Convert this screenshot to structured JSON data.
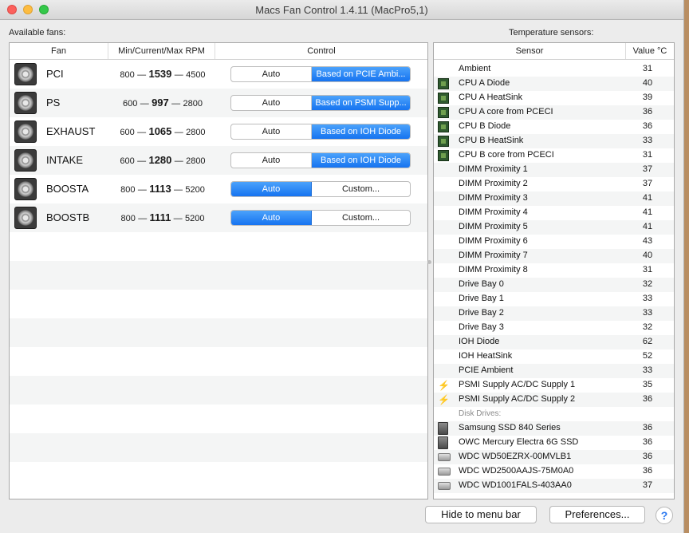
{
  "window": {
    "title": "Macs Fan Control 1.4.11 (MacPro5,1)"
  },
  "fans_panel": {
    "label": "Available fans:",
    "headers": {
      "fan": "Fan",
      "rpm": "Min/Current/Max RPM",
      "control": "Control"
    },
    "dash": "—",
    "rows": [
      {
        "name": "PCI",
        "min": "800",
        "current": "1539",
        "max": "4500",
        "auto": "Auto",
        "option": "Based on PCIE Ambi...",
        "mode": "custom"
      },
      {
        "name": "PS",
        "min": "600",
        "current": "997",
        "max": "2800",
        "auto": "Auto",
        "option": "Based on PSMI Supp...",
        "mode": "custom"
      },
      {
        "name": "EXHAUST",
        "min": "600",
        "current": "1065",
        "max": "2800",
        "auto": "Auto",
        "option": "Based on IOH Diode",
        "mode": "custom"
      },
      {
        "name": "INTAKE",
        "min": "600",
        "current": "1280",
        "max": "2800",
        "auto": "Auto",
        "option": "Based on IOH Diode",
        "mode": "custom"
      },
      {
        "name": "BOOSTA",
        "min": "800",
        "current": "1113",
        "max": "5200",
        "auto": "Auto",
        "option": "Custom...",
        "mode": "auto"
      },
      {
        "name": "BOOSTB",
        "min": "800",
        "current": "1111",
        "max": "5200",
        "auto": "Auto",
        "option": "Custom...",
        "mode": "auto"
      }
    ]
  },
  "sensors_panel": {
    "label": "Temperature sensors:",
    "headers": {
      "sensor": "Sensor",
      "value": "Value °C"
    },
    "rows": [
      {
        "name": "Ambient",
        "value": "31",
        "icon": "none"
      },
      {
        "name": "CPU A Diode",
        "value": "40",
        "icon": "chip"
      },
      {
        "name": "CPU A HeatSink",
        "value": "39",
        "icon": "chip"
      },
      {
        "name": "CPU A core from PCECI",
        "value": "36",
        "icon": "chip"
      },
      {
        "name": "CPU B Diode",
        "value": "36",
        "icon": "chip"
      },
      {
        "name": "CPU B HeatSink",
        "value": "33",
        "icon": "chip"
      },
      {
        "name": "CPU B core from PCECI",
        "value": "31",
        "icon": "chip"
      },
      {
        "name": "DIMM Proximity 1",
        "value": "37",
        "icon": "none"
      },
      {
        "name": "DIMM Proximity 2",
        "value": "37",
        "icon": "none"
      },
      {
        "name": "DIMM Proximity 3",
        "value": "41",
        "icon": "none"
      },
      {
        "name": "DIMM Proximity 4",
        "value": "41",
        "icon": "none"
      },
      {
        "name": "DIMM Proximity 5",
        "value": "41",
        "icon": "none"
      },
      {
        "name": "DIMM Proximity 6",
        "value": "43",
        "icon": "none"
      },
      {
        "name": "DIMM Proximity 7",
        "value": "40",
        "icon": "none"
      },
      {
        "name": "DIMM Proximity 8",
        "value": "31",
        "icon": "none"
      },
      {
        "name": "Drive Bay 0",
        "value": "32",
        "icon": "none"
      },
      {
        "name": "Drive Bay 1",
        "value": "33",
        "icon": "none"
      },
      {
        "name": "Drive Bay 2",
        "value": "33",
        "icon": "none"
      },
      {
        "name": "Drive Bay 3",
        "value": "32",
        "icon": "none"
      },
      {
        "name": "IOH Diode",
        "value": "62",
        "icon": "none"
      },
      {
        "name": "IOH HeatSink",
        "value": "52",
        "icon": "none"
      },
      {
        "name": "PCIE Ambient",
        "value": "33",
        "icon": "none"
      },
      {
        "name": "PSMI Supply AC/DC Supply 1",
        "value": "35",
        "icon": "bolt"
      },
      {
        "name": "PSMI Supply AC/DC Supply 2",
        "value": "36",
        "icon": "bolt"
      },
      {
        "group": "Disk Drives:"
      },
      {
        "name": "Samsung SSD 840 Series",
        "value": "36",
        "icon": "ssd"
      },
      {
        "name": "OWC Mercury Electra 6G SSD",
        "value": "36",
        "icon": "ssd"
      },
      {
        "name": "WDC WD50EZRX-00MVLB1",
        "value": "36",
        "icon": "hdd"
      },
      {
        "name": "WDC WD2500AAJS-75M0A0",
        "value": "36",
        "icon": "hdd"
      },
      {
        "name": "WDC WD1001FALS-403AA0",
        "value": "37",
        "icon": "hdd"
      }
    ]
  },
  "footer": {
    "hide_label": "Hide to menu bar",
    "prefs_label": "Preferences...",
    "help_label": "?"
  }
}
